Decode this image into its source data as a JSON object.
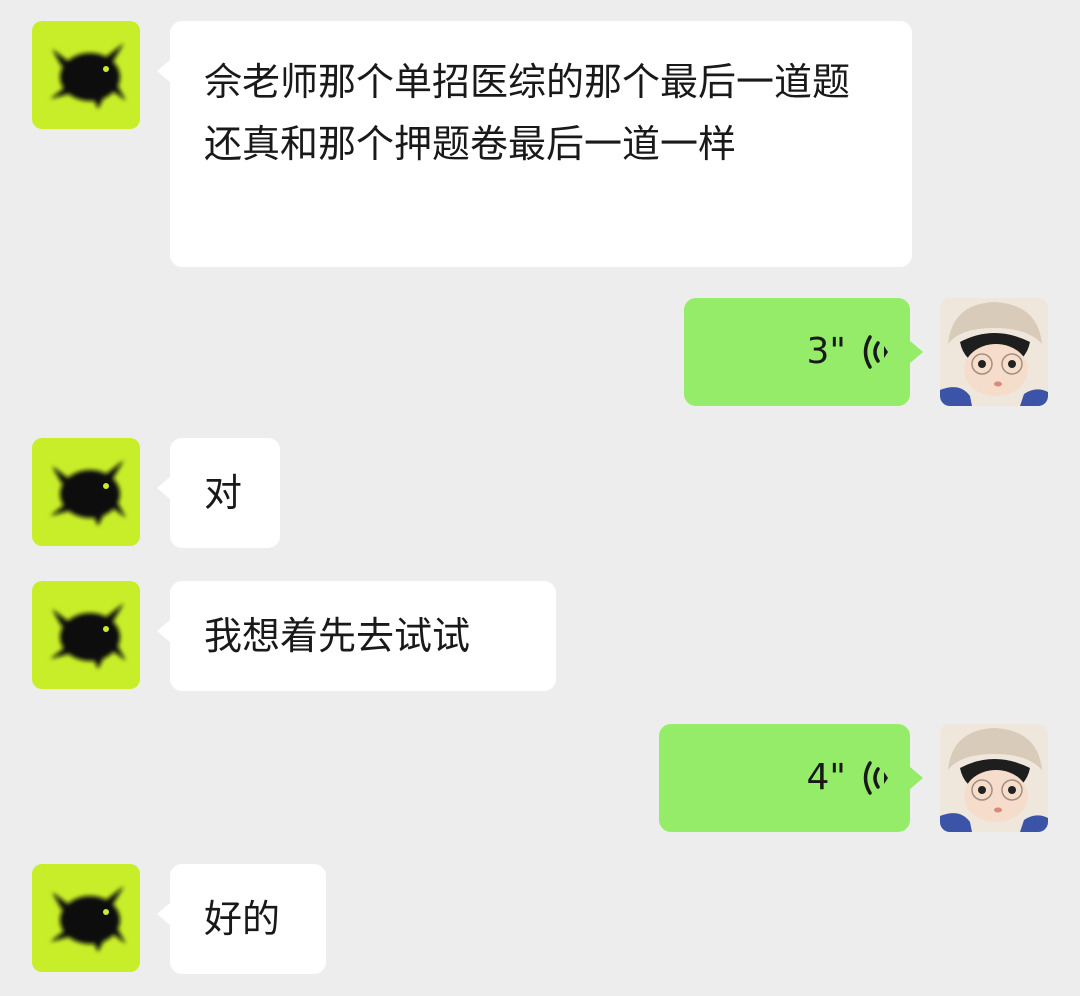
{
  "messages": [
    {
      "side": "in",
      "type": "text",
      "text": "佘老师那个单招医综的那个最后一道题还真和那个押题卷最后一道一样"
    },
    {
      "side": "out",
      "type": "voice",
      "duration": "3\""
    },
    {
      "side": "in",
      "type": "text",
      "text": "对"
    },
    {
      "side": "in",
      "type": "text",
      "text": "我想着先去试试"
    },
    {
      "side": "out",
      "type": "voice",
      "duration": "4\""
    },
    {
      "side": "in",
      "type": "text",
      "text": "好的"
    }
  ],
  "icons": {
    "voice": "voice-wave-icon",
    "contact_avatar": "black-cat-on-lime-avatar",
    "self_avatar": "child-with-glasses-avatar"
  },
  "colors": {
    "background": "#ededed",
    "incoming_bubble": "#ffffff",
    "outgoing_bubble": "#95ec69",
    "contact_avatar_bg": "#c8ee2a"
  }
}
